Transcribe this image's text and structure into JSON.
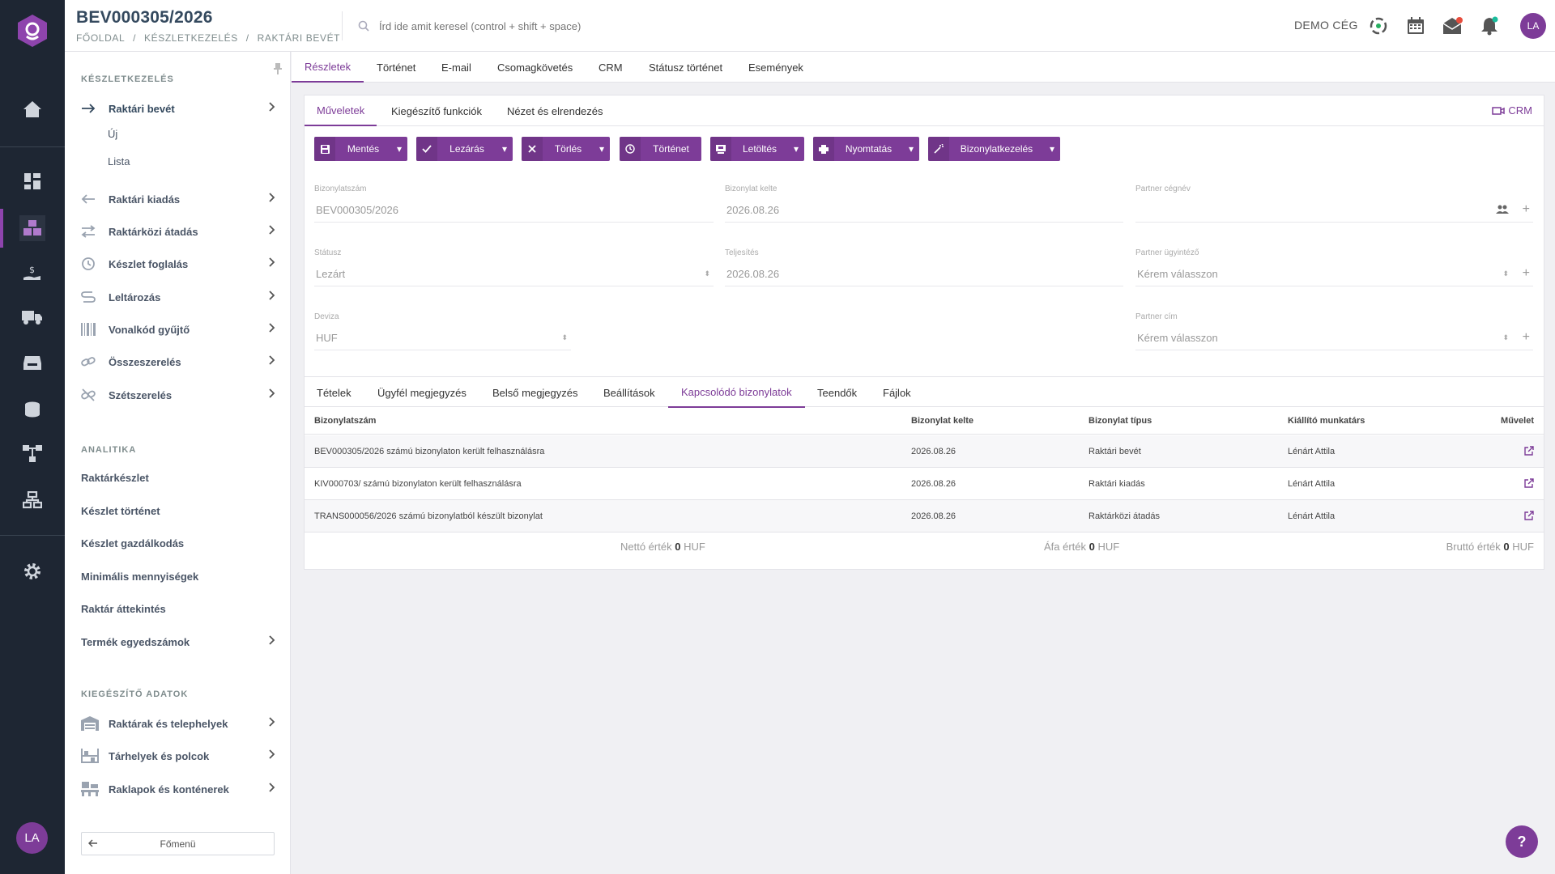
{
  "header": {
    "title": "BEV000305/2026",
    "breadcrumb": [
      "FŐOLDAL",
      "/",
      "KÉSZLETKEZELÉS",
      "/",
      "RAKTÁRI BEVÉT"
    ],
    "search_placeholder": "Írd ide amit keresel (control + shift + space)",
    "company": "DEMO CÉG",
    "avatar": "LA"
  },
  "rail": {
    "avatar": "LA"
  },
  "sidebar": {
    "section_main": "KÉSZLETKEZELÉS",
    "items": [
      {
        "label": "Raktári bevét",
        "icon": "arrow-right-icon"
      },
      {
        "label": "Raktári kiadás",
        "icon": "arrow-left-icon"
      },
      {
        "label": "Raktárközi átadás",
        "icon": "transfer-icon"
      },
      {
        "label": "Készlet foglalás",
        "icon": "reserve-icon"
      },
      {
        "label": "Leltározás",
        "icon": "inventory-icon"
      },
      {
        "label": "Vonalkód gyűjtő",
        "icon": "barcode-icon"
      },
      {
        "label": "Összeszerelés",
        "icon": "link-icon"
      },
      {
        "label": "Szétszerelés",
        "icon": "unlink-icon"
      }
    ],
    "subitems": [
      "Új",
      "Lista"
    ],
    "section_analytics": "ANALITIKA",
    "analytics": [
      "Raktárkészlet",
      "Készlet történet",
      "Készlet gazdálkodás",
      "Minimális mennyiségek",
      "Raktár áttekintés",
      "Termék egyedszámok"
    ],
    "section_extra": "KIEGÉSZÍTŐ ADATOK",
    "extra": [
      {
        "label": "Raktárak és telephelyek",
        "icon": "warehouse-icon"
      },
      {
        "label": "Tárhelyek és polcok",
        "icon": "shelf-icon"
      },
      {
        "label": "Raklapok és konténerek",
        "icon": "pallet-icon"
      }
    ],
    "main_menu": "Főmenü"
  },
  "top_tabs": [
    "Részletek",
    "Történet",
    "E-mail",
    "Csomagkövetés",
    "CRM",
    "Státusz történet",
    "Események"
  ],
  "sub_tabs": [
    "Műveletek",
    "Kiegészítő funkciók",
    "Nézet és elrendezés"
  ],
  "crm_link": "CRM",
  "buttons": {
    "save": "Mentés",
    "close": "Lezárás",
    "delete": "Törlés",
    "history": "Történet",
    "download": "Letöltés",
    "print": "Nyomtatás",
    "doc": "Bizonylatkezelés"
  },
  "form": {
    "doc_number_label": "Bizonylatszám",
    "doc_number": "BEV000305/2026",
    "doc_date_label": "Bizonylat kelte",
    "doc_date": "2026.08.26",
    "partner_name_label": "Partner cégnév",
    "status_label": "Státusz",
    "status": "Lezárt",
    "fulfillment_label": "Teljesítés",
    "fulfillment": "2026.08.26",
    "partner_agent_label": "Partner ügyintéző",
    "partner_agent": "Kérem válasszon",
    "currency_label": "Deviza",
    "currency": "HUF",
    "partner_address_label": "Partner cím",
    "partner_address": "Kérem válasszon"
  },
  "detail_tabs": [
    "Tételek",
    "Ügyfél megjegyzés",
    "Belső megjegyzés",
    "Beállítások",
    "Kapcsolódó bizonylatok",
    "Teendők",
    "Fájlok"
  ],
  "table": {
    "headers": [
      "Bizonylatszám",
      "Bizonylat kelte",
      "Bizonylat típus",
      "Kiállító munkatárs",
      "Művelet"
    ],
    "rows": [
      [
        "BEV000305/2026 számú bizonylaton került felhasználásra",
        "2026.08.26",
        "Raktári bevét",
        "Lénárt Attila"
      ],
      [
        "KIV000703/ számú bizonylaton került felhasználásra",
        "2026.08.26",
        "Raktári kiadás",
        "Lénárt Attila"
      ],
      [
        "TRANS000056/2026 számú bizonylatból készült bizonylat",
        "2026.08.26",
        "Raktárközi átadás",
        "Lénárt Attila"
      ]
    ]
  },
  "totals": {
    "net_label": "Nettó érték",
    "net_value": "0",
    "net_cur": "HUF",
    "vat_label": "Áfa érték",
    "vat_value": "0",
    "vat_cur": "HUF",
    "gross_label": "Bruttó érték",
    "gross_value": "0",
    "gross_cur": "HUF"
  },
  "help": "?",
  "colors": {
    "accent": "#7d3c98",
    "rail": "#1e2633"
  }
}
